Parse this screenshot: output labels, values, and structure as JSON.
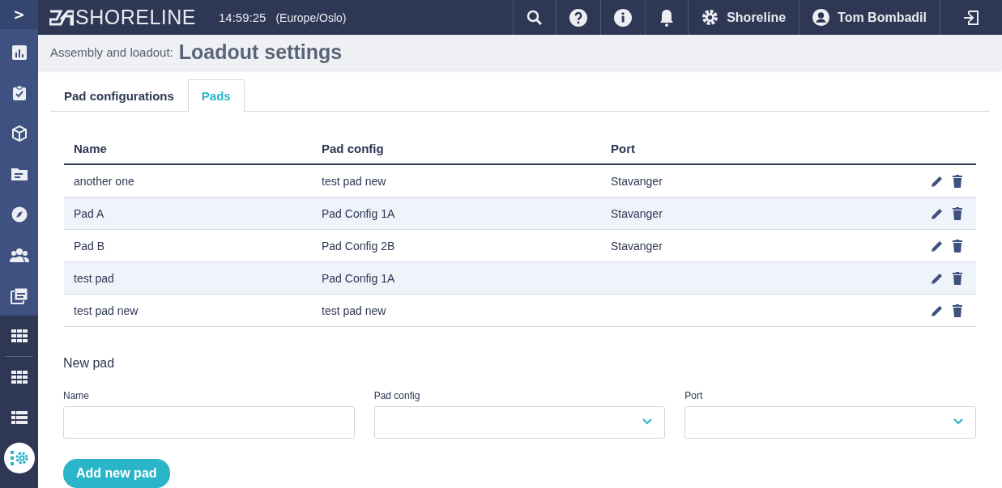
{
  "sidebar": {
    "toggle": ">",
    "items": [
      {
        "selected": false
      },
      {
        "selected": false
      },
      {
        "selected": false
      },
      {
        "selected": false
      },
      {
        "selected": false
      },
      {
        "selected": false
      },
      {
        "selected": false
      },
      {
        "selected": false
      },
      {
        "selected": false
      },
      {
        "selected": false
      },
      {
        "selected": true
      }
    ]
  },
  "topbar": {
    "logo": "SHORELINE",
    "time": "14:59:25",
    "timezone": "(Europe/Oslo)",
    "organization": "Shoreline",
    "user": "Tom Bombadil"
  },
  "header": {
    "breadcrumb": "Assembly and loadout:",
    "title": "Loadout settings"
  },
  "tabs": [
    {
      "label": "Pad configurations",
      "selected": false
    },
    {
      "label": "Pads",
      "selected": true
    }
  ],
  "table": {
    "columns": [
      "Name",
      "Pad config",
      "Port"
    ],
    "rows": [
      [
        "another one",
        "test pad new",
        "Stavanger"
      ],
      [
        "Pad A",
        "Pad Config 1A",
        "Stavanger"
      ],
      [
        "Pad B",
        "Pad Config 2B",
        "Stavanger"
      ],
      [
        "test pad",
        "Pad Config 1A",
        ""
      ],
      [
        "test pad new",
        "test pad new",
        ""
      ]
    ]
  },
  "form": {
    "title": "New pad",
    "fields": [
      {
        "label": "Name",
        "kind": "text"
      },
      {
        "label": "Pad config",
        "kind": "select"
      },
      {
        "label": "Port",
        "kind": "select"
      }
    ],
    "submit": "Add new pad"
  }
}
